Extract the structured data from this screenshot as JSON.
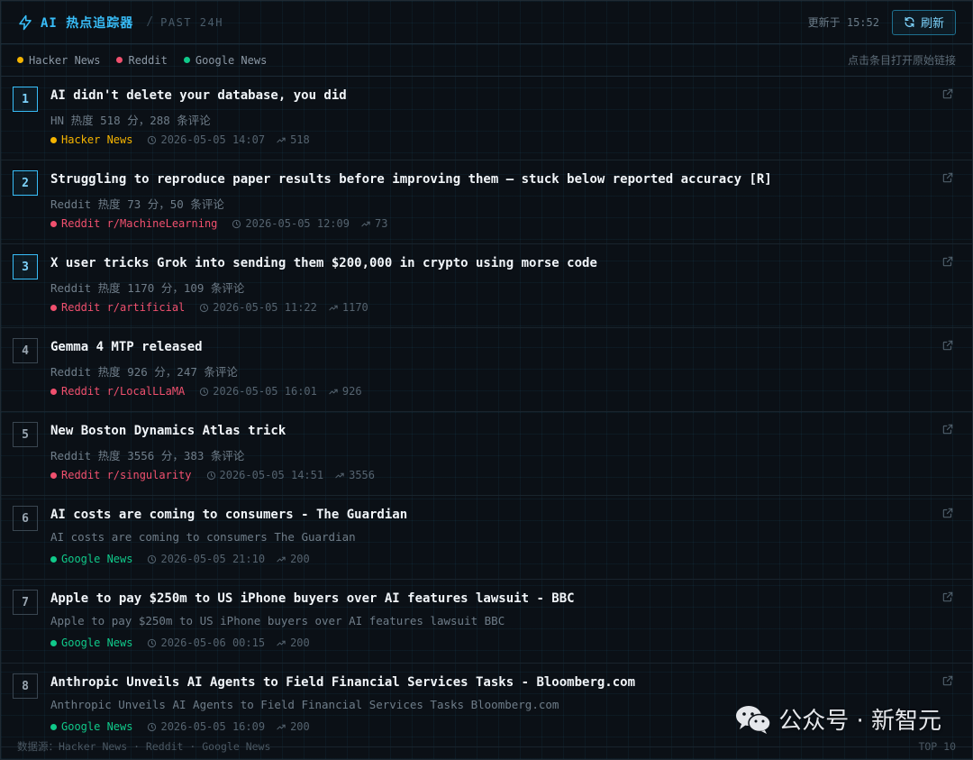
{
  "header": {
    "title": "AI 热点追踪器",
    "separator": "/",
    "subtitle": "PAST 24H",
    "updated": "更新于 15:52",
    "refresh_label": "刷新"
  },
  "legend": {
    "items": [
      {
        "label": "Hacker News",
        "color": "#f5b400"
      },
      {
        "label": "Reddit",
        "color": "#f0506e"
      },
      {
        "label": "Google News",
        "color": "#10c98a"
      }
    ],
    "hint": "点击条目打开原始链接"
  },
  "colors": {
    "accent": "#38bdf8",
    "hacker_news": "#f5b400",
    "reddit": "#f0506e",
    "google_news": "#10c98a"
  },
  "items": [
    {
      "rank": "1",
      "title": "AI didn't delete your database, you did",
      "desc": "HN 热度 518 分，288 条评论",
      "source": "Hacker News",
      "source_key": "hacker_news",
      "time": "2026-05-05 14:07",
      "score": "518"
    },
    {
      "rank": "2",
      "title": "Struggling to reproduce paper results before improving them — stuck below reported accuracy [R]",
      "desc": "Reddit 热度 73 分，50 条评论",
      "source": "Reddit r/MachineLearning",
      "source_key": "reddit",
      "time": "2026-05-05 12:09",
      "score": "73"
    },
    {
      "rank": "3",
      "title": "X user tricks Grok into sending them $200,000 in crypto using morse code",
      "desc": "Reddit 热度 1170 分，109 条评论",
      "source": "Reddit r/artificial",
      "source_key": "reddit",
      "time": "2026-05-05 11:22",
      "score": "1170"
    },
    {
      "rank": "4",
      "title": "Gemma 4 MTP released",
      "desc": "Reddit 热度 926 分，247 条评论",
      "source": "Reddit r/LocalLLaMA",
      "source_key": "reddit",
      "time": "2026-05-05 16:01",
      "score": "926"
    },
    {
      "rank": "5",
      "title": "New Boston Dynamics Atlas trick",
      "desc": "Reddit 热度 3556 分，383 条评论",
      "source": "Reddit r/singularity",
      "source_key": "reddit",
      "time": "2026-05-05 14:51",
      "score": "3556"
    },
    {
      "rank": "6",
      "title": "AI costs are coming to consumers - The Guardian",
      "desc": "AI costs are coming to consumers  The Guardian",
      "source": "Google News",
      "source_key": "google_news",
      "time": "2026-05-05 21:10",
      "score": "200"
    },
    {
      "rank": "7",
      "title": "Apple to pay $250m to US iPhone buyers over AI features lawsuit - BBC",
      "desc": "Apple to pay $250m to US iPhone buyers over AI features lawsuit  BBC",
      "source": "Google News",
      "source_key": "google_news",
      "time": "2026-05-06 00:15",
      "score": "200"
    },
    {
      "rank": "8",
      "title": "Anthropic Unveils AI Agents to Field Financial Services Tasks - Bloomberg.com",
      "desc": "Anthropic Unveils AI Agents to Field Financial Services Tasks  Bloomberg.com",
      "source": "Google News",
      "source_key": "google_news",
      "time": "2026-05-05 16:09",
      "score": "200"
    }
  ],
  "footer": {
    "sources": "数据源：Hacker News · Reddit · Google News",
    "top": "TOP 10"
  },
  "watermark": {
    "text": "公众号 · 新智元"
  }
}
